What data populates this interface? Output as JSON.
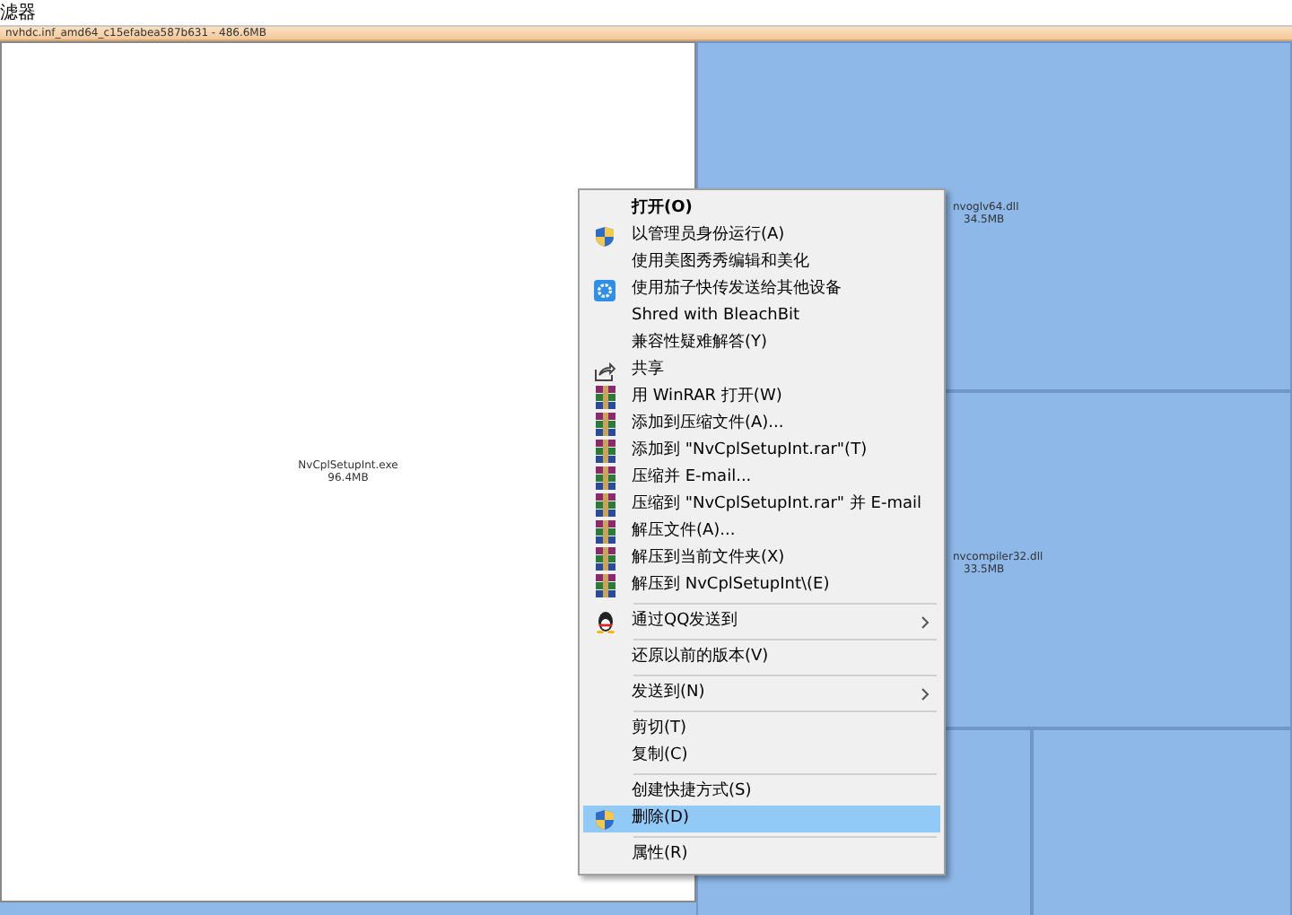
{
  "filter_label": "滤器",
  "header": {
    "title": "nvhdc.inf_amd64_c15efabea587b631 - 486.6MB"
  },
  "tiles": [
    {
      "name": "NvCplSetupInt.exe",
      "size": "96.4MB",
      "selected": true
    },
    {
      "name": "nvoglv64.dll",
      "size": "34.5MB",
      "selected": false
    },
    {
      "name": "nvcompiler32.dll",
      "size": "33.5MB",
      "selected": false
    }
  ],
  "context_menu": {
    "groups": [
      [
        {
          "label": "打开(O)",
          "kind": "plain",
          "default": true,
          "submenu": false,
          "selected": false
        },
        {
          "label": "以管理员身份运行(A)",
          "kind": "shield",
          "default": false,
          "submenu": false,
          "selected": false
        },
        {
          "label": "使用美图秀秀编辑和美化",
          "kind": "plain",
          "default": false,
          "submenu": false,
          "selected": false
        },
        {
          "label": "使用茄子快传发送给其他设备",
          "kind": "gear",
          "default": false,
          "submenu": false,
          "selected": false
        },
        {
          "label": "Shred with BleachBit",
          "kind": "plain",
          "default": false,
          "submenu": false,
          "selected": false
        },
        {
          "label": "兼容性疑难解答(Y)",
          "kind": "plain",
          "default": false,
          "submenu": false,
          "selected": false
        },
        {
          "label": "共享",
          "kind": "share",
          "default": false,
          "submenu": false,
          "selected": false
        },
        {
          "label": "用 WinRAR 打开(W)",
          "kind": "archive",
          "default": false,
          "submenu": false,
          "selected": false
        },
        {
          "label": "添加到压缩文件(A)...",
          "kind": "archive",
          "default": false,
          "submenu": false,
          "selected": false
        },
        {
          "label": "添加到 \"NvCplSetupInt.rar\"(T)",
          "kind": "archive",
          "default": false,
          "submenu": false,
          "selected": false
        },
        {
          "label": "压缩并 E-mail...",
          "kind": "archive",
          "default": false,
          "submenu": false,
          "selected": false
        },
        {
          "label": "压缩到 \"NvCplSetupInt.rar\" 并 E-mail",
          "kind": "archive",
          "default": false,
          "submenu": false,
          "selected": false
        },
        {
          "label": "解压文件(A)...",
          "kind": "archive",
          "default": false,
          "submenu": false,
          "selected": false
        },
        {
          "label": "解压到当前文件夹(X)",
          "kind": "archive",
          "default": false,
          "submenu": false,
          "selected": false
        },
        {
          "label": "解压到 NvCplSetupInt\\(E)",
          "kind": "archive",
          "default": false,
          "submenu": false,
          "selected": false
        }
      ],
      [
        {
          "label": "通过QQ发送到",
          "kind": "qq",
          "default": false,
          "submenu": true,
          "selected": false
        }
      ],
      [
        {
          "label": "还原以前的版本(V)",
          "kind": "plain",
          "default": false,
          "submenu": false,
          "selected": false
        }
      ],
      [
        {
          "label": "发送到(N)",
          "kind": "plain",
          "default": false,
          "submenu": true,
          "selected": false
        }
      ],
      [
        {
          "label": "剪切(T)",
          "kind": "plain",
          "default": false,
          "submenu": false,
          "selected": false
        },
        {
          "label": "复制(C)",
          "kind": "plain",
          "default": false,
          "submenu": false,
          "selected": false
        }
      ],
      [
        {
          "label": "创建快捷方式(S)",
          "kind": "plain",
          "default": false,
          "submenu": false,
          "selected": false
        },
        {
          "label": "删除(D)",
          "kind": "shield",
          "default": false,
          "submenu": false,
          "selected": true
        }
      ],
      [
        {
          "label": "属性(R)",
          "kind": "plain",
          "default": false,
          "submenu": false,
          "selected": false
        }
      ]
    ]
  }
}
